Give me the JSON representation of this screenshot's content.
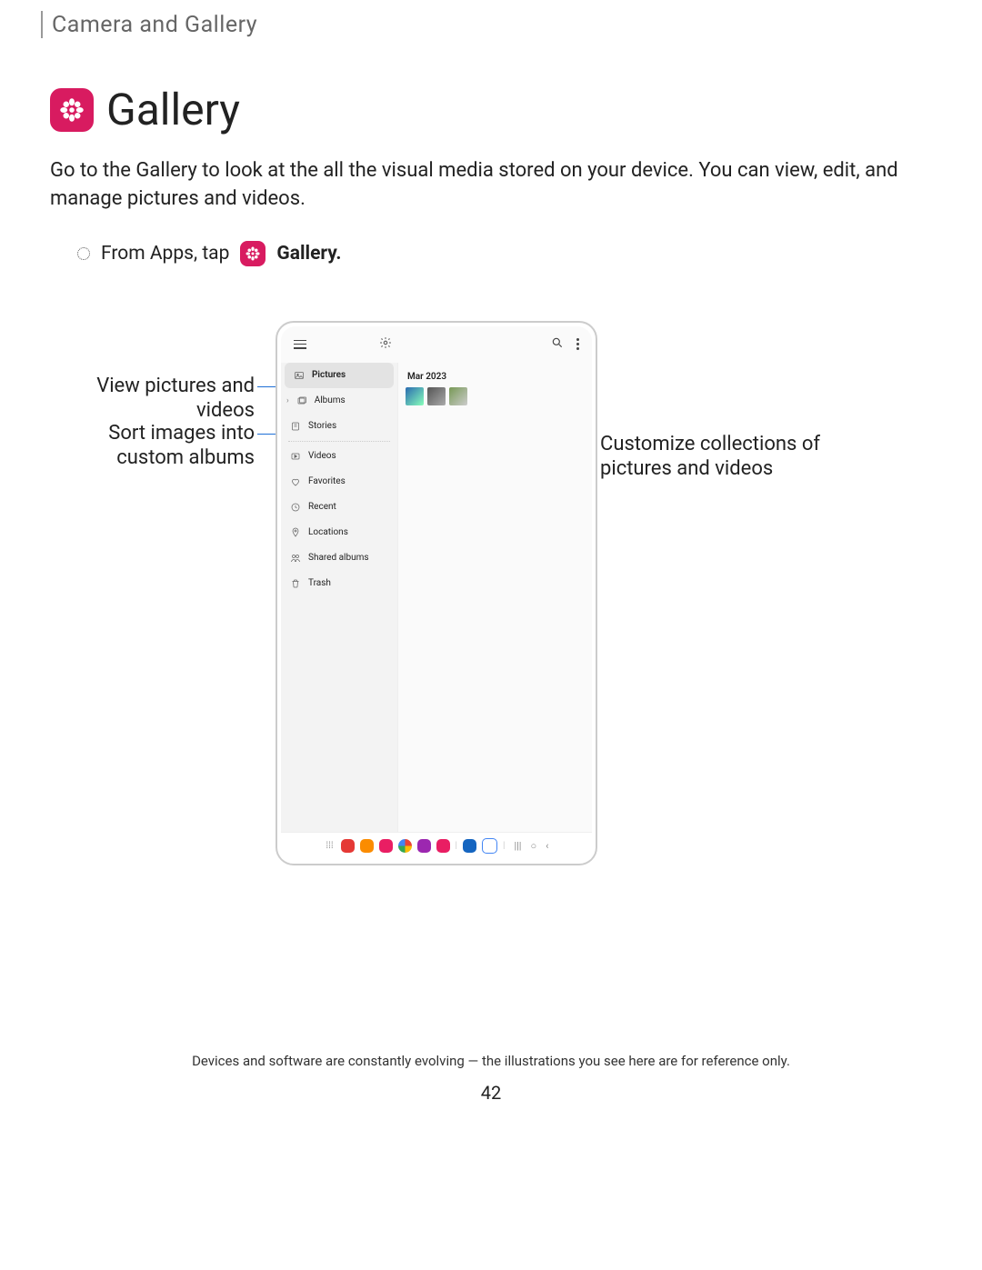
{
  "header": {
    "section": "Camera and Gallery"
  },
  "title": "Gallery",
  "intro": "Go to the Gallery to look at the all the visual media stored on your device. You can view, edit, and manage pictures and videos.",
  "step": {
    "prefix": "From Apps, tap ",
    "appname": "Gallery.",
    "icon": "gallery-icon"
  },
  "callouts": {
    "left1": "View pictures and videos",
    "left2": "Sort images into custom albums",
    "right1": "Customize collections of pictures and videos"
  },
  "device": {
    "date": "Mar 2023",
    "nav": [
      {
        "label": "Pictures",
        "icon": "image-icon",
        "selected": true
      },
      {
        "label": "Albums",
        "icon": "album-icon",
        "expandable": true
      },
      {
        "label": "Stories",
        "icon": "story-icon"
      },
      {
        "label": "Videos",
        "icon": "video-icon"
      },
      {
        "label": "Favorites",
        "icon": "heart-icon"
      },
      {
        "label": "Recent",
        "icon": "clock-icon"
      },
      {
        "label": "Locations",
        "icon": "location-icon"
      },
      {
        "label": "Shared albums",
        "icon": "shared-icon"
      },
      {
        "label": "Trash",
        "icon": "trash-icon"
      }
    ]
  },
  "footer": {
    "note": "Devices and software are constantly evolving — the illustrations you see here are for reference only.",
    "page": "42"
  }
}
